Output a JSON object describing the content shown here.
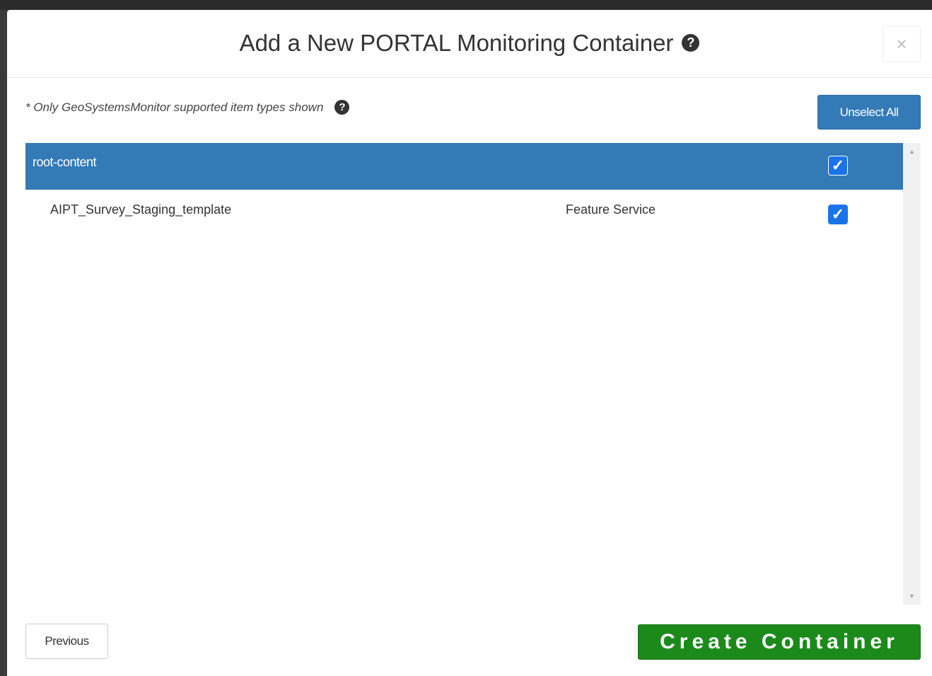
{
  "dialog": {
    "title": "Add a New PORTAL Monitoring Container",
    "help_glyph": "?",
    "close_glyph": "×"
  },
  "note": {
    "text": "* Only GeoSystemsMonitor supported item types shown",
    "help_glyph": "?"
  },
  "toolbar": {
    "unselect_all_label": "Unselect All"
  },
  "tree": {
    "root": {
      "label": "root-content",
      "checked": true,
      "check_glyph": "✓"
    },
    "items": [
      {
        "label": "AIPT_Survey_Staging_template",
        "type": "Feature Service",
        "checked": true,
        "check_glyph": "✓"
      }
    ]
  },
  "scrollbar": {
    "up_glyph": "▲",
    "down_glyph": "▼"
  },
  "footer": {
    "previous_label": "Previous",
    "create_label": "Create Container"
  },
  "colors": {
    "primary": "#337ab7",
    "success": "#1b8a1b",
    "checkbox": "#1a73e8"
  }
}
